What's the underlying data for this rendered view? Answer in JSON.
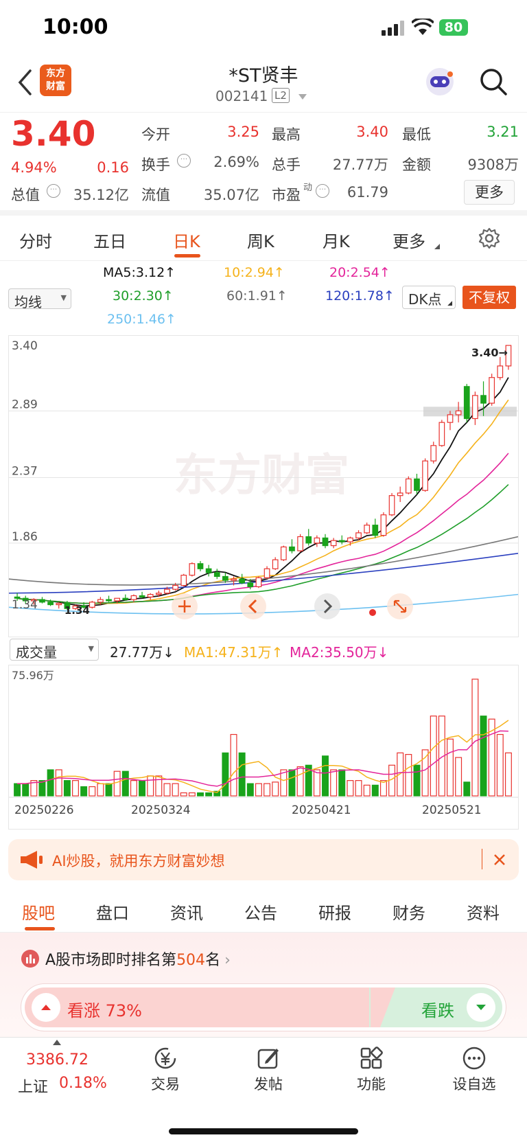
{
  "status": {
    "time": "10:00",
    "battery": "80"
  },
  "header": {
    "logo_line1": "东方",
    "logo_line2": "财富",
    "title": "*ST贤丰",
    "code": "002141",
    "level": "L2"
  },
  "quote": {
    "price": "3.40",
    "pct": "4.94%",
    "change": "0.16",
    "open_l": "今开",
    "open_v": "3.25",
    "high_l": "最高",
    "high_v": "3.40",
    "low_l": "最低",
    "low_v": "3.21",
    "turn_l": "换手",
    "turn_v": "2.69%",
    "vol_l": "总手",
    "vol_v": "27.77万",
    "amt_l": "金额",
    "amt_v": "9308万",
    "mcap_l": "总值",
    "mcap_v": "35.12亿",
    "float_l": "流值",
    "float_v": "35.07亿",
    "pe_l": "市盈",
    "pe_sup": "动",
    "pe_v": "61.79",
    "more": "更多"
  },
  "tabs": [
    "分时",
    "五日",
    "日K",
    "周K",
    "月K",
    "更多"
  ],
  "ma": {
    "selector": "均线",
    "ma5": "MA5:3.12↑",
    "ma10": "10:2.94↑",
    "ma20": "20:2.54↑",
    "ma30": "30:2.30↑",
    "ma60": "60:1.91↑",
    "ma120": "120:1.78↑",
    "ma250": "250:1.46↑",
    "dk": "DK点",
    "fuquan": "不复权"
  },
  "chart_data": {
    "type": "candlestick",
    "y_ticks": [
      "3.40",
      "2.89",
      "2.37",
      "1.86",
      "1.34"
    ],
    "ylim": [
      1.26,
      3.4
    ],
    "last_label": "3.40→",
    "low_label": "1.34",
    "watermark": "东方财富",
    "ohlc": [
      [
        1.44,
        1.47,
        1.41,
        1.43
      ],
      [
        1.43,
        1.45,
        1.39,
        1.41
      ],
      [
        1.41,
        1.43,
        1.38,
        1.42
      ],
      [
        1.42,
        1.44,
        1.39,
        1.4
      ],
      [
        1.4,
        1.42,
        1.37,
        1.38
      ],
      [
        1.38,
        1.4,
        1.35,
        1.39
      ],
      [
        1.39,
        1.41,
        1.34,
        1.35
      ],
      [
        1.35,
        1.38,
        1.34,
        1.37
      ],
      [
        1.37,
        1.4,
        1.35,
        1.36
      ],
      [
        1.36,
        1.41,
        1.35,
        1.4
      ],
      [
        1.4,
        1.44,
        1.38,
        1.42
      ],
      [
        1.42,
        1.45,
        1.4,
        1.41
      ],
      [
        1.41,
        1.43,
        1.39,
        1.43
      ],
      [
        1.43,
        1.46,
        1.41,
        1.42
      ],
      [
        1.42,
        1.46,
        1.4,
        1.45
      ],
      [
        1.45,
        1.48,
        1.43,
        1.44
      ],
      [
        1.44,
        1.47,
        1.42,
        1.46
      ],
      [
        1.46,
        1.49,
        1.44,
        1.47
      ],
      [
        1.47,
        1.52,
        1.46,
        1.5
      ],
      [
        1.5,
        1.55,
        1.49,
        1.53
      ],
      [
        1.53,
        1.62,
        1.52,
        1.61
      ],
      [
        1.61,
        1.71,
        1.6,
        1.7
      ],
      [
        1.7,
        1.72,
        1.64,
        1.66
      ],
      [
        1.66,
        1.69,
        1.6,
        1.63
      ],
      [
        1.63,
        1.66,
        1.58,
        1.6
      ],
      [
        1.6,
        1.63,
        1.55,
        1.57
      ],
      [
        1.57,
        1.6,
        1.53,
        1.58
      ],
      [
        1.58,
        1.62,
        1.54,
        1.55
      ],
      [
        1.55,
        1.58,
        1.5,
        1.52
      ],
      [
        1.52,
        1.6,
        1.51,
        1.59
      ],
      [
        1.59,
        1.68,
        1.58,
        1.66
      ],
      [
        1.66,
        1.75,
        1.65,
        1.73
      ],
      [
        1.73,
        1.84,
        1.72,
        1.83
      ],
      [
        1.83,
        1.89,
        1.78,
        1.8
      ],
      [
        1.8,
        1.93,
        1.79,
        1.91
      ],
      [
        1.91,
        1.97,
        1.84,
        1.86
      ],
      [
        1.86,
        1.92,
        1.83,
        1.9
      ],
      [
        1.9,
        1.93,
        1.82,
        1.84
      ],
      [
        1.84,
        1.9,
        1.82,
        1.88
      ],
      [
        1.88,
        1.92,
        1.85,
        1.87
      ],
      [
        1.87,
        1.91,
        1.84,
        1.9
      ],
      [
        1.9,
        1.96,
        1.88,
        1.94
      ],
      [
        1.94,
        2.02,
        1.93,
        2.0
      ],
      [
        2.0,
        2.05,
        1.9,
        1.92
      ],
      [
        1.92,
        2.1,
        1.91,
        2.08
      ],
      [
        2.08,
        2.25,
        2.07,
        2.23
      ],
      [
        2.23,
        2.3,
        2.18,
        2.25
      ],
      [
        2.25,
        2.38,
        2.24,
        2.36
      ],
      [
        2.36,
        2.4,
        2.24,
        2.27
      ],
      [
        2.27,
        2.52,
        2.26,
        2.5
      ],
      [
        2.5,
        2.65,
        2.48,
        2.62
      ],
      [
        2.62,
        2.82,
        2.61,
        2.8
      ],
      [
        2.8,
        2.89,
        2.74,
        2.86
      ],
      [
        2.86,
        2.96,
        2.8,
        2.89
      ],
      [
        3.08,
        3.1,
        2.8,
        2.83
      ],
      [
        2.83,
        3.04,
        2.78,
        3.01
      ],
      [
        3.01,
        3.12,
        2.85,
        2.95
      ],
      [
        2.95,
        3.18,
        2.93,
        3.15
      ],
      [
        3.15,
        3.31,
        3.13,
        3.24
      ],
      [
        3.24,
        3.4,
        3.21,
        3.4
      ]
    ]
  },
  "volume": {
    "selector": "成交量",
    "vol": "27.77万↓",
    "ma1": "MA1:47.31万↑",
    "ma2": "MA2:35.50万↓",
    "max_label": "75.96万",
    "dates": [
      "20250226",
      "20250324",
      "20250421",
      "20250521"
    ],
    "values": [
      8,
      8,
      10,
      10,
      17,
      17,
      10,
      10,
      6,
      6,
      8,
      8,
      16,
      16,
      10,
      10,
      13,
      13,
      8,
      8,
      2,
      2,
      2,
      2,
      3,
      28,
      40,
      28,
      8,
      8,
      8,
      9,
      17,
      17,
      19,
      20,
      17,
      26,
      17,
      17,
      10,
      10,
      7,
      7,
      10,
      20,
      28,
      27,
      20,
      30,
      52,
      52,
      37,
      25,
      9,
      76,
      52,
      50,
      40,
      28
    ]
  },
  "banner": {
    "text": "AI炒股，就用东方财富妙想"
  },
  "subtabs": [
    "股吧",
    "盘口",
    "资讯",
    "公告",
    "研报",
    "财务",
    "资料"
  ],
  "rank": {
    "prefix": "A股市场即时排名第",
    "num": "504",
    "suffix": "名"
  },
  "sentiment": {
    "up": "看涨 73%",
    "down": "看跌",
    "up_ratio": 0.73
  },
  "bottom": {
    "index_value": "3386.72",
    "index_name": "上证",
    "index_pct": "0.18%",
    "nav": [
      "交易",
      "发帖",
      "功能",
      "设自选"
    ]
  },
  "colors": {
    "up": "#e8322e",
    "down": "#19a31b",
    "accent": "#e8541c",
    "ma5": "#111111",
    "ma10": "#f5b21b",
    "ma20": "#e3249a",
    "ma30": "#1f9e2a",
    "ma60": "#777777",
    "ma120": "#2a3fbf",
    "ma250": "#6cc0f0"
  }
}
